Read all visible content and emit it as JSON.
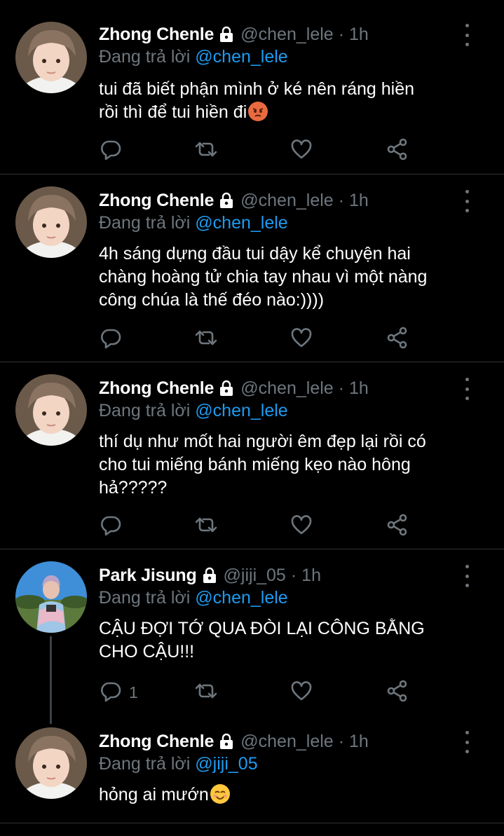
{
  "tweets": [
    {
      "name": "Zhong Chenle",
      "handle": "@chen_lele",
      "time": "1h",
      "reply_label": "Đang trả lời",
      "reply_to": "@chen_lele",
      "lines": [
        "tui đã biết phận mình ở ké nên ráng hiền",
        "rồi thì để tui hiền đi"
      ],
      "trailing_emoji": "angry-face-emoji",
      "reply_count": ""
    },
    {
      "name": "Zhong Chenle",
      "handle": "@chen_lele",
      "time": "1h",
      "reply_label": "Đang trả lời",
      "reply_to": "@chen_lele",
      "lines": [
        "4h sáng dựng đầu tui dậy kể chuyện hai",
        "chàng hoàng tử chia tay nhau vì một nàng",
        "công chúa là thế đéo nào:))))"
      ],
      "reply_count": ""
    },
    {
      "name": "Zhong Chenle",
      "handle": "@chen_lele",
      "time": "1h",
      "reply_label": "Đang trả lời",
      "reply_to": "@chen_lele",
      "lines": [
        "thí dụ như mốt hai người êm đẹp lại rồi có",
        "cho tui miếng bánh miếng kẹo nào hông",
        "hả?????"
      ],
      "reply_count": ""
    },
    {
      "name": "Park Jisung",
      "handle": "@jiji_05",
      "time": "1h",
      "reply_label": "Đang trả lời",
      "reply_to": "@chen_lele",
      "lines": [
        "CẬU ĐỢI TỚ QUA ĐÒI LẠI CÔNG BẰNG",
        "CHO CẬU!!!"
      ],
      "reply_count": "1"
    },
    {
      "name": "Zhong Chenle",
      "handle": "@chen_lele",
      "time": "1h",
      "reply_label": "Đang trả lời",
      "reply_to": "@jiji_05",
      "lines": [
        "hỏng ai mướn"
      ],
      "trailing_emoji": "smiling-face-emoji",
      "reply_count": ""
    }
  ],
  "separator": "·",
  "colors": {
    "background": "#000000",
    "text": "#ffffff",
    "muted": "#6e767d",
    "link": "#1d9bf0",
    "divider": "#2f3336"
  },
  "icons": [
    "lock-icon",
    "more-vertical-icon",
    "reply-icon",
    "retweet-icon",
    "like-icon",
    "share-icon"
  ]
}
